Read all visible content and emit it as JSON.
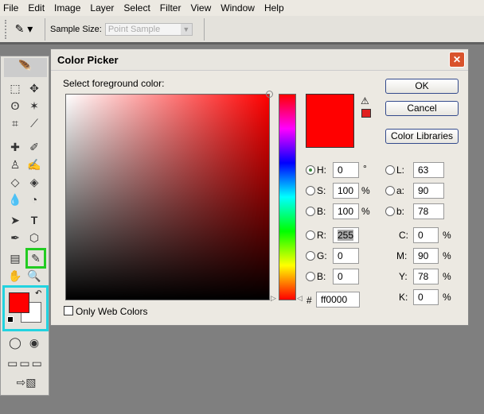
{
  "menu": [
    "File",
    "Edit",
    "Image",
    "Layer",
    "Select",
    "Filter",
    "View",
    "Window",
    "Help"
  ],
  "options": {
    "sample_size_label": "Sample Size:",
    "sample_size_value": "Point Sample"
  },
  "dialog": {
    "title": "Color Picker",
    "prompt": "Select foreground color:",
    "ok": "OK",
    "cancel": "Cancel",
    "libraries": "Color Libraries",
    "only_web": "Only Web Colors",
    "current_color": "#ff0000",
    "hsb": [
      {
        "label": "H:",
        "value": "0",
        "unit": "°",
        "selected": true
      },
      {
        "label": "S:",
        "value": "100",
        "unit": "%"
      },
      {
        "label": "B:",
        "value": "100",
        "unit": "%"
      }
    ],
    "rgb": [
      {
        "label": "R:",
        "value": "255"
      },
      {
        "label": "G:",
        "value": "0"
      },
      {
        "label": "B:",
        "value": "0"
      }
    ],
    "lab": [
      {
        "label": "L:",
        "value": "63"
      },
      {
        "label": "a:",
        "value": "90"
      },
      {
        "label": "b:",
        "value": "78"
      }
    ],
    "cmyk": [
      {
        "label": "C:",
        "value": "0",
        "unit": "%"
      },
      {
        "label": "M:",
        "value": "90",
        "unit": "%"
      },
      {
        "label": "Y:",
        "value": "78",
        "unit": "%"
      },
      {
        "label": "K:",
        "value": "0",
        "unit": "%"
      }
    ],
    "hex_label": "#",
    "hex": "ff0000"
  },
  "colors": {
    "foreground": "#ff0000",
    "background": "#ffffff",
    "highlight_green": "#22cc22",
    "highlight_cyan": "#22d3e0"
  }
}
